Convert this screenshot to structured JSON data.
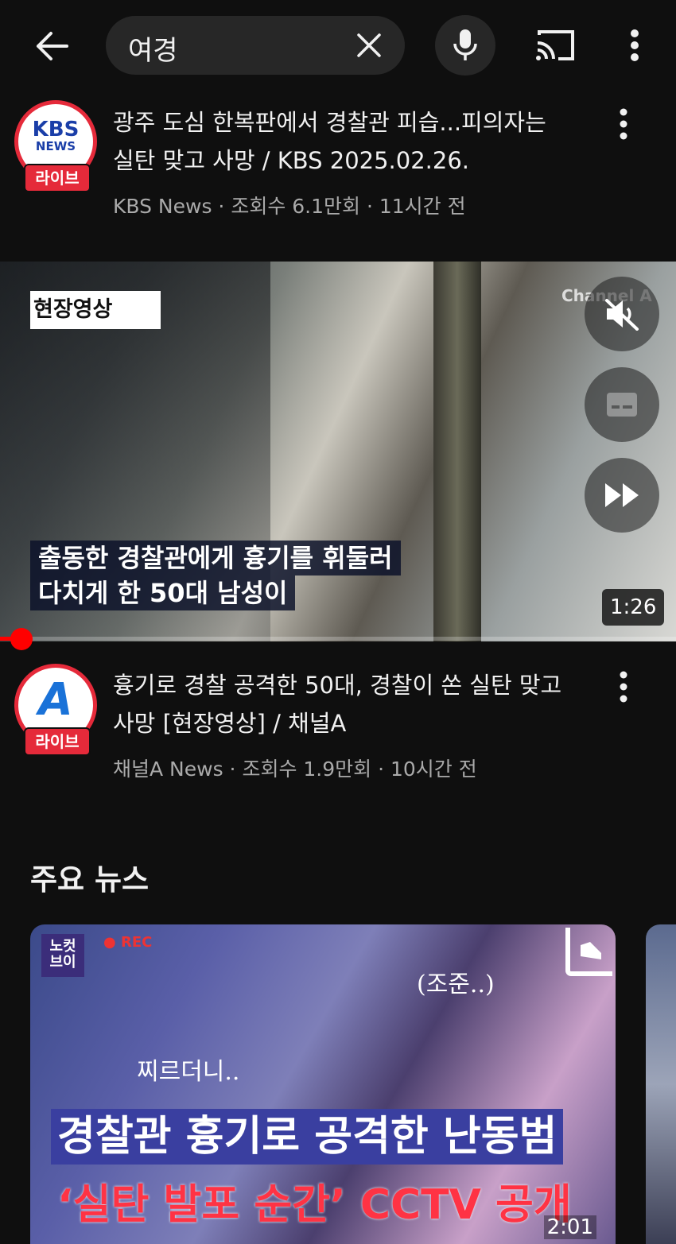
{
  "search": {
    "query": "여경"
  },
  "results": [
    {
      "title_line1": "광주 도심 한복판에서 경찰관 피습...피의자는",
      "title_line2": "실탄 맞고 사망 / KBS  2025.02.26.",
      "meta": "KBS News · 조회수 6.1만회 · 11시간 전",
      "avatar_text": "KBS",
      "avatar_sub": "NEWS",
      "live_label": "라이브"
    },
    {
      "title_line1": "흉기로 경찰 공격한 50대, 경찰이 쏜 실탄 맞고",
      "title_line2": "사망 [현장영상] / 채널A",
      "meta": "채널A News · 조회수 1.9만회 · 10시간 전",
      "avatar_text": "A",
      "live_label": "라이브"
    }
  ],
  "video": {
    "chip": "현장영상",
    "watermark": "Channel A",
    "caption_line1": "출동한 경찰관에게 흉기를 휘둘러",
    "caption_line2": "다치게 한 50대 남성이",
    "duration": "1:26",
    "progress": 0.03
  },
  "section": {
    "title": "주요 뉴스",
    "card": {
      "logo": "노컷\n브이",
      "rec": "● REC",
      "aside1": "(조준..)",
      "aside2": "찌르더니..",
      "headline1": "경찰관 흉기로 공격한 난동범",
      "headline2": "‘실탄 발포 순간’ CCTV 공개",
      "duration": "2:01"
    }
  },
  "colors": {
    "background": "#0f0f0f",
    "accent": "#ff0000",
    "live": "#e52a3a"
  }
}
